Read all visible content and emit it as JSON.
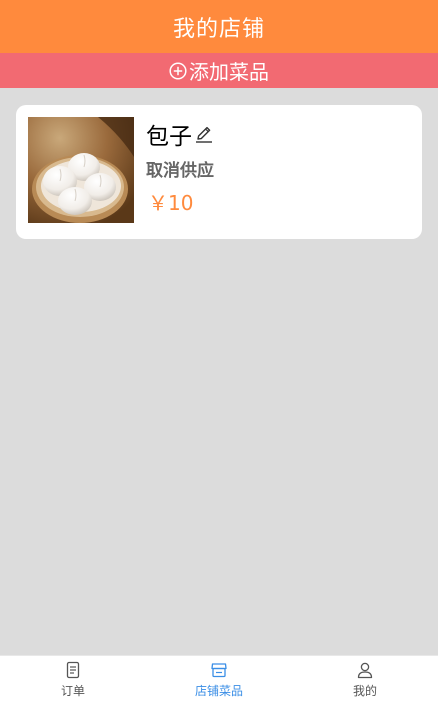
{
  "header": {
    "title": "我的店铺"
  },
  "add_bar": {
    "label": "添加菜品"
  },
  "dishes": [
    {
      "name": "包子",
      "status_action": "取消供应",
      "price": "￥10"
    }
  ],
  "tabbar": {
    "items": [
      {
        "label": "订单",
        "icon": "document-icon",
        "active": false
      },
      {
        "label": "店铺菜品",
        "icon": "store-icon",
        "active": true
      },
      {
        "label": "我的",
        "icon": "user-icon",
        "active": false
      }
    ]
  },
  "colors": {
    "header_bg": "#ff8a3d",
    "add_bar_bg": "#f26a72",
    "price": "#ff8a3d",
    "active_tab": "#3a8ee6",
    "background": "#dcdcdc"
  }
}
